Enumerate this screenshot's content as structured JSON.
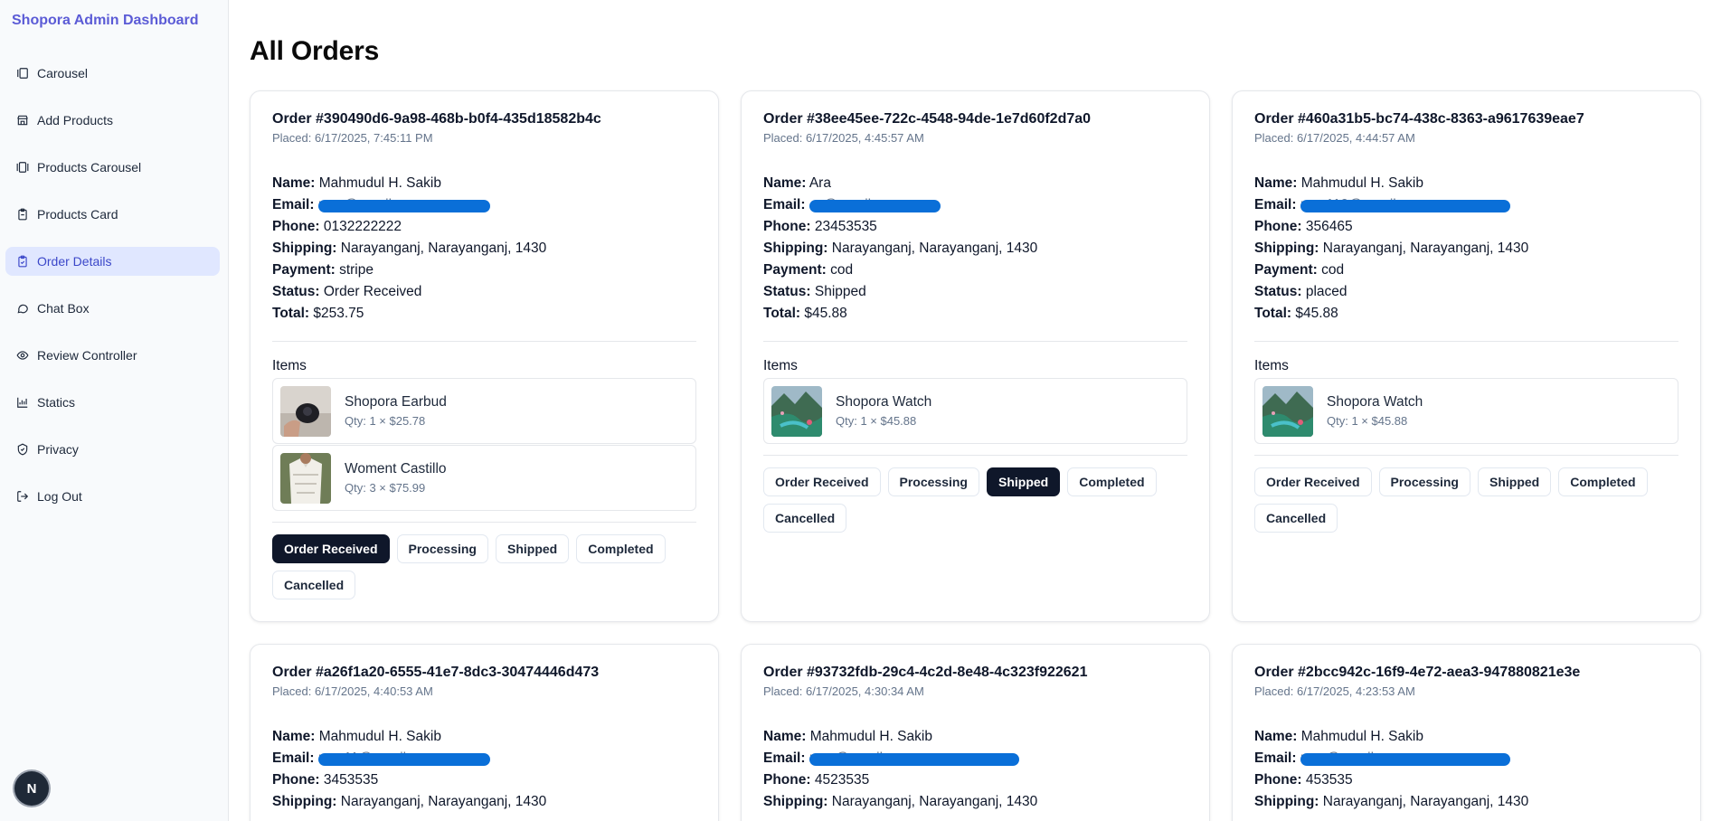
{
  "brand": "Shopora Admin Dashboard",
  "nav": [
    {
      "label": "Carousel",
      "icon": "carousel-icon"
    },
    {
      "label": "Add Products",
      "icon": "store-icon"
    },
    {
      "label": "Products Carousel",
      "icon": "gallery-icon"
    },
    {
      "label": "Products Card",
      "icon": "clipboard-icon"
    },
    {
      "label": "Order Details",
      "icon": "clipboard-check-icon",
      "active": true
    },
    {
      "label": "Chat Box",
      "icon": "message-icon"
    },
    {
      "label": "Review Controller",
      "icon": "eye-icon"
    },
    {
      "label": "Statics",
      "icon": "bar-chart-icon"
    },
    {
      "label": "Privacy",
      "icon": "shield-icon"
    },
    {
      "label": "Log Out",
      "icon": "logout-icon"
    }
  ],
  "avatar": "N",
  "page_title": "All Orders",
  "labels": {
    "name": "Name:",
    "email": "Email:",
    "phone": "Phone:",
    "shipping": "Shipping:",
    "payment": "Payment:",
    "status": "Status:",
    "total": "Total:",
    "items": "Items"
  },
  "status_buttons": [
    "Order Received",
    "Processing",
    "Shipped",
    "Completed",
    "Cancelled"
  ],
  "orders": [
    {
      "id": "Order #390490d6-9a98-468b-b0f4-435d18582b4c",
      "placed": "Placed: 6/17/2025, 7:45:11 PM",
      "name": "Mahmudul H. Sakib",
      "email": "m…@gmail.com",
      "phone": "0132222222",
      "shipping": "Narayanganj, Narayanganj, 1430",
      "payment": "stripe",
      "status": "Order Received",
      "total": "$253.75",
      "items": [
        {
          "name": "Shopora Earbud",
          "qty": "Qty: 1 × $25.78",
          "thumb": "earbud"
        },
        {
          "name": "Woment Castillo",
          "qty": "Qty: 3 × $75.99",
          "thumb": "shirt"
        }
      ],
      "active": 0
    },
    {
      "id": "Order #38ee45ee-722c-4548-94de-1e7d60f2d7a0",
      "placed": "Placed: 6/17/2025, 4:45:57 AM",
      "name": "Ara",
      "email": "…@gmail.com",
      "phone": "23453535",
      "shipping": "Narayanganj, Narayanganj, 1430",
      "payment": "cod",
      "status": "Shipped",
      "total": "$45.88",
      "items": [
        {
          "name": "Shopora Watch",
          "qty": "Qty: 1 × $45.88",
          "thumb": "landscape"
        }
      ],
      "active": 2
    },
    {
      "id": "Order #460a31b5-bc74-438c-8363-a9617639eae7",
      "placed": "Placed: 6/17/2025, 4:44:57 AM",
      "name": "Mahmudul H. Sakib",
      "email": "m…110@gmail.com",
      "phone": "356465",
      "shipping": "Narayanganj, Narayanganj, 1430",
      "payment": "cod",
      "status": "placed",
      "total": "$45.88",
      "items": [
        {
          "name": "Shopora Watch",
          "qty": "Qty: 1 × $45.88",
          "thumb": "landscape"
        }
      ],
      "active": -1
    },
    {
      "id": "Order #a26f1a20-6555-41e7-8dc3-30474446d473",
      "placed": "Placed: 6/17/2025, 4:40:53 AM",
      "name": "Mahmudul H. Sakib",
      "email": "m…11@gmail.com",
      "phone": "3453535",
      "shipping": "Narayanganj, Narayanganj, 1430",
      "payment": "",
      "status": "",
      "total": "",
      "items": [],
      "active": -1
    },
    {
      "id": "Order #93732fdb-29c4-4c2d-8e48-4c323f922621",
      "placed": "Placed: 6/17/2025, 4:30:34 AM",
      "name": "Mahmudul H. Sakib",
      "email": "m…@gmail.com",
      "phone": "4523535",
      "shipping": "Narayanganj, Narayanganj, 1430",
      "payment": "",
      "status": "",
      "total": "",
      "items": [],
      "active": -1
    },
    {
      "id": "Order #2bcc942c-16f9-4e72-aea3-947880821e3e",
      "placed": "Placed: 6/17/2025, 4:23:53 AM",
      "name": "Mahmudul H. Sakib",
      "email": "m…@gmail.com",
      "phone": "453535",
      "shipping": "Narayanganj, Narayanganj, 1430",
      "payment": "",
      "status": "",
      "total": "",
      "items": [],
      "active": -1
    }
  ]
}
